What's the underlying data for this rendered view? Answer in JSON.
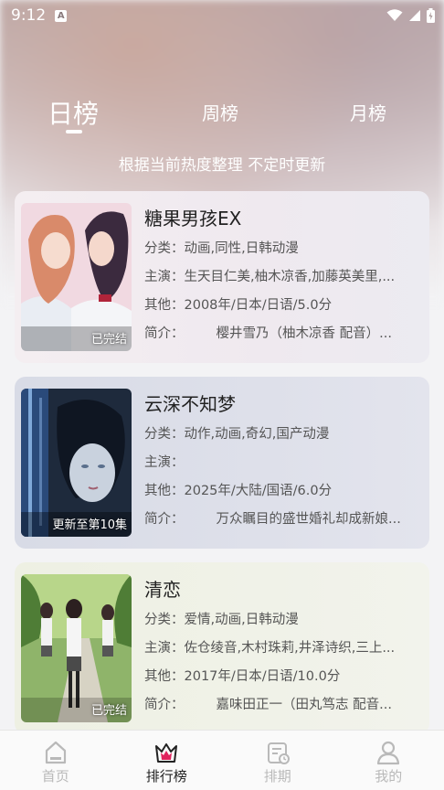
{
  "status": {
    "time": "9:12"
  },
  "tabs": {
    "day": "日榜",
    "week": "周榜",
    "month": "月榜"
  },
  "subtitle": "根据当前热度整理 不定时更新",
  "items": [
    {
      "title": "糖果男孩EX",
      "category_label": "分类：",
      "category": "动画,同性,日韩动漫",
      "cast_label": "主演：",
      "cast": "生天目仁美,柚木凉香,加藤英美里,...",
      "other_label": "其他：",
      "other": "2008年/日本/日语/5.0分",
      "intro_label": "简介：",
      "intro": "樱井雪乃（柚木凉香 配音）...",
      "badge": "已完结"
    },
    {
      "title": "云深不知梦",
      "category_label": "分类：",
      "category": "动作,动画,奇幻,国产动漫",
      "cast_label": "主演：",
      "cast": "",
      "other_label": "其他：",
      "other": "2025年/大陆/国语/6.0分",
      "intro_label": "简介：",
      "intro": "万众瞩目的盛世婚礼却成新娘...",
      "badge": "更新至第10集"
    },
    {
      "title": "清恋",
      "category_label": "分类：",
      "category": "爱情,动画,日韩动漫",
      "cast_label": "主演：",
      "cast": "佐仓绫音,木村珠莉,井泽诗织,三上...",
      "other_label": "其他：",
      "other": "2017年/日本/日语/10.0分",
      "intro_label": "简介：",
      "intro": "嘉味田正一（田丸笃志 配音...",
      "badge": "已完结"
    }
  ],
  "nav": [
    {
      "label": "首页",
      "icon": "home-icon"
    },
    {
      "label": "排行榜",
      "icon": "crown-icon"
    },
    {
      "label": "排期",
      "icon": "calendar-icon"
    },
    {
      "label": "我的",
      "icon": "user-icon"
    }
  ],
  "colors": {
    "active_nav": "#222222",
    "inactive_nav": "#b9b9b9",
    "crown": "#e0245e"
  }
}
